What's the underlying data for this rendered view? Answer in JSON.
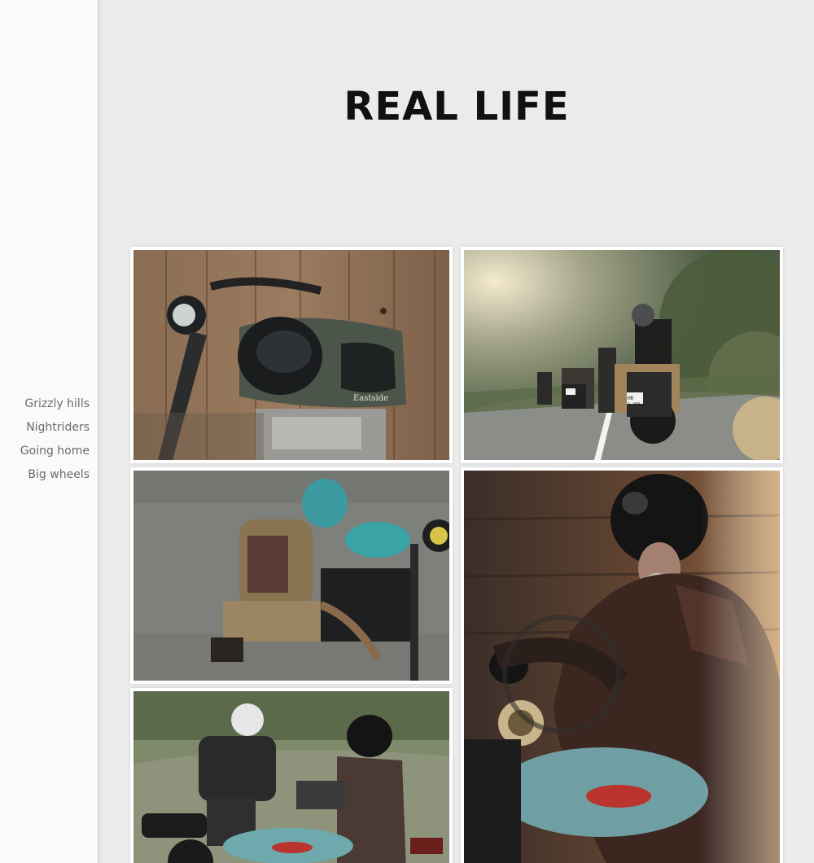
{
  "page": {
    "title": "REAL LIFE"
  },
  "sidebar": {
    "items": [
      {
        "label": "Grizzly hills"
      },
      {
        "label": "Nightriders"
      },
      {
        "label": "Going home"
      },
      {
        "label": "Big wheels"
      }
    ]
  },
  "gallery": {
    "photos": [
      {
        "name": "photo-motorcycle-wooden-wall",
        "caption": "Eastside"
      },
      {
        "name": "photo-riders-roadside",
        "plates": [
          "HR",
          "1 293"
        ]
      },
      {
        "name": "photo-mechanic-kneeling"
      },
      {
        "name": "photo-bearded-rider"
      },
      {
        "name": "photo-two-riders"
      }
    ]
  },
  "colors": {
    "sidebar_bg": "#fafafa",
    "page_bg": "#ebebeb",
    "nav_text": "#6b6b6b",
    "title_text": "#111111"
  }
}
